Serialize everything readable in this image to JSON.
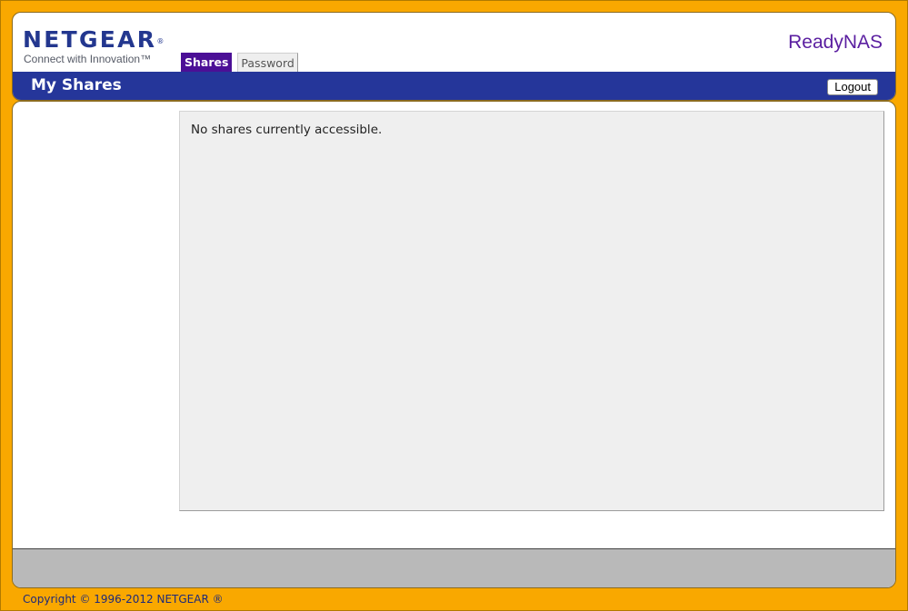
{
  "header": {
    "logo_text": "NETGEAR",
    "logo_registered_mark": "®",
    "logo_tagline": "Connect with Innovation™",
    "product_name": "ReadyNAS"
  },
  "tabs": [
    {
      "label": "Shares",
      "active": true
    },
    {
      "label": "Password",
      "active": false
    }
  ],
  "title_bar": {
    "page_title": "My Shares",
    "logout_label": "Logout"
  },
  "content": {
    "empty_message": "No shares currently accessible."
  },
  "footer": {
    "copyright": "Copyright © 1996-2012 NETGEAR ®"
  },
  "colors": {
    "frame_orange": "#f9a800",
    "brand_blue": "#25369a",
    "active_tab_purple": "#4b0f96",
    "product_purple": "#5a1ea0",
    "panel_gray": "#efefef",
    "footer_gray": "#b9b9b9"
  }
}
